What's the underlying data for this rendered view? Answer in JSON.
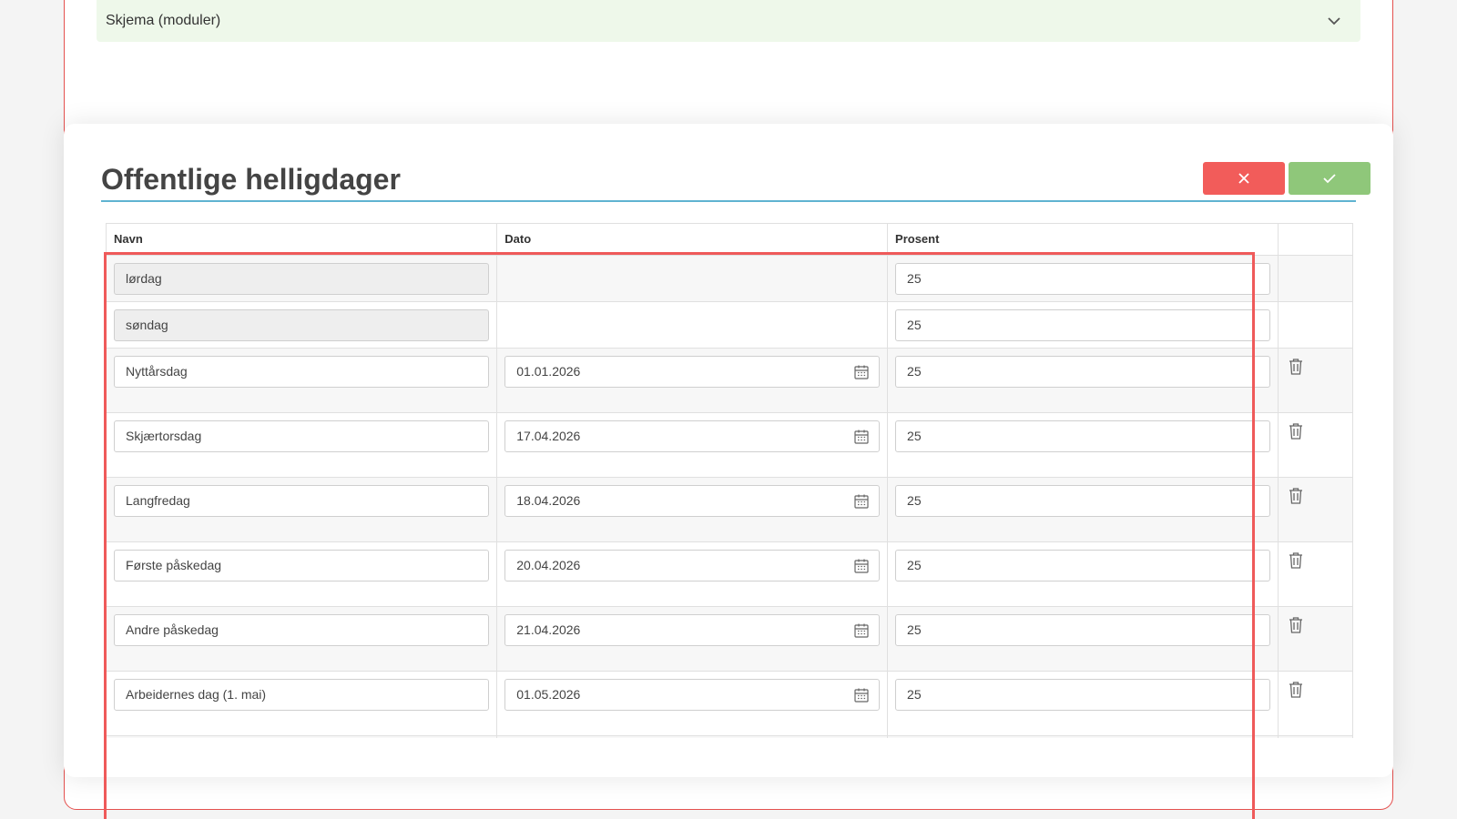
{
  "accordion": {
    "label": "Skjema (moduler)",
    "icon": "chevron-down-icon"
  },
  "modal": {
    "title": "Offentlige helligdager",
    "cancel_icon": "close-icon",
    "confirm_icon": "check-icon",
    "colors": {
      "cancel": "#f25c5a",
      "confirm": "#8fc77a",
      "title_underline": "#5fb3d1",
      "highlight": "#ef5a5a"
    }
  },
  "table": {
    "headers": {
      "name": "Navn",
      "date": "Dato",
      "percent": "Prosent"
    },
    "rows": [
      {
        "name": "lørdag",
        "date": "",
        "percent": "25",
        "readonly": true
      },
      {
        "name": "søndag",
        "date": "",
        "percent": "25",
        "readonly": true
      },
      {
        "name": "Nyttårsdag",
        "date": "01.01.2026",
        "percent": "25"
      },
      {
        "name": "Skjærtorsdag",
        "date": "17.04.2026",
        "percent": "25"
      },
      {
        "name": "Langfredag",
        "date": "18.04.2026",
        "percent": "25"
      },
      {
        "name": "Første påskedag",
        "date": "20.04.2026",
        "percent": "25"
      },
      {
        "name": "Andre påskedag",
        "date": "21.04.2026",
        "percent": "25"
      },
      {
        "name": "Arbeidernes dag (1. mai)",
        "date": "01.05.2026",
        "percent": "25"
      }
    ]
  }
}
